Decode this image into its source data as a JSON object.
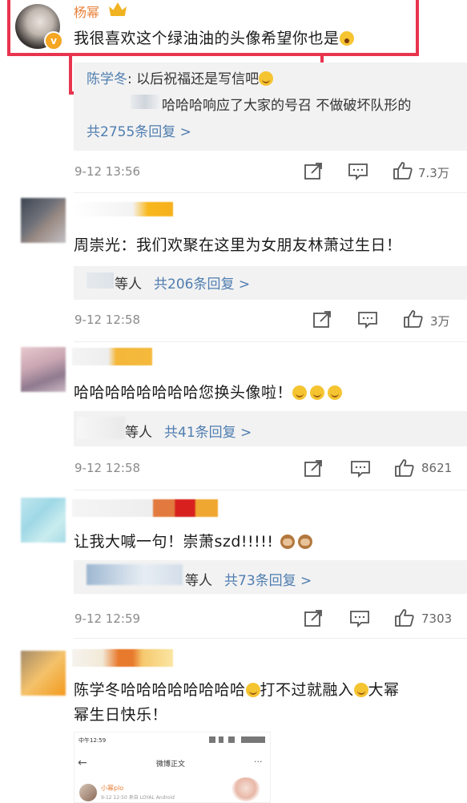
{
  "comments": [
    {
      "name": "杨幂",
      "text": "我很喜欢这个绿油油的头像希望你也是",
      "reply_preview_name": "陈学冬",
      "reply_preview_text": "以后祝福还是写信吧",
      "reply_second_line": "哈哈哈响应了大家的号召  不做破坏队形的",
      "reply_more": "共2755条回复 >",
      "time": "9-12 13:56",
      "likes": "7.3万"
    },
    {
      "text": "周崇光：我们欢聚在这里为女朋友林萧过生日！",
      "reply_prefix": "等人",
      "reply_more": "共206条回复 >",
      "time": "9-12 12:58",
      "likes": "3万"
    },
    {
      "text": "哈哈哈哈哈哈哈哈您换头像啦！",
      "reply_prefix": "等人",
      "reply_more": "共41条回复 >",
      "time": "9-12 12:58",
      "likes": "8621"
    },
    {
      "text": "让我大喊一句！崇萧szd!!!!!",
      "reply_prefix": "等人",
      "reply_more": "共73条回复 >",
      "time": "9-12 12:59",
      "likes": "7303"
    },
    {
      "text_line1": "陈学冬哈哈哈哈哈哈哈哈",
      "text_mid": "打不过就融入",
      "text_end1": "大幂",
      "text_line2": "幂生日快乐！"
    }
  ],
  "embedded": {
    "status_time": "中午12:59",
    "title": "微博正文",
    "more": "···",
    "user": "小幂plo",
    "meta": "9-12 12:50  来自 LOYAL Android"
  },
  "icons": [
    "share-icon",
    "comment-icon",
    "like-icon",
    "chevron-right-icon",
    "verified-badge-icon",
    "crown-icon"
  ],
  "colors": {
    "highlight_border": "#e8344e",
    "link": "#4f7db0",
    "name_orange": "#e9813a",
    "verified": "#f5a623"
  }
}
